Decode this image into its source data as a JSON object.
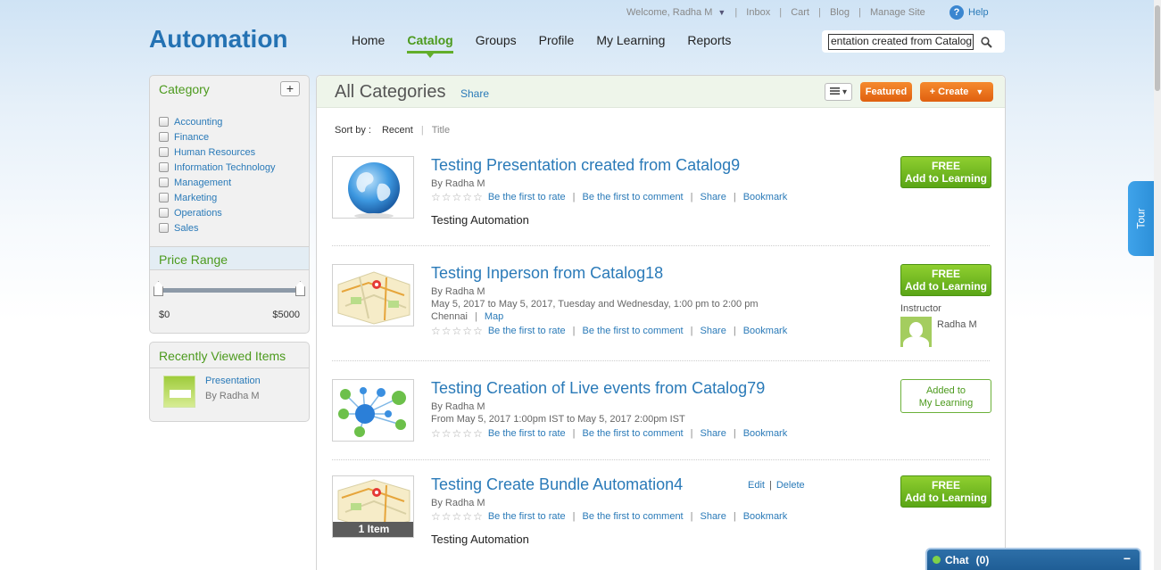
{
  "topbar": {
    "welcome": "Welcome, Radha M",
    "links": [
      "Inbox",
      "Cart",
      "Blog",
      "Manage Site"
    ],
    "help": "Help"
  },
  "logo": "Automation",
  "nav": [
    "Home",
    "Catalog",
    "Groups",
    "Profile",
    "My Learning",
    "Reports"
  ],
  "nav_active": "Catalog",
  "search": {
    "value": "entation created from Catalog"
  },
  "sidebar": {
    "category_title": "Category",
    "add_label": "+",
    "categories": [
      "Accounting",
      "Finance",
      "Human Resources",
      "Information Technology",
      "Management",
      "Marketing",
      "Operations",
      "Sales"
    ],
    "price_title": "Price Range",
    "price_min": "$0",
    "price_max": "$5000",
    "recent_title": "Recently Viewed Items",
    "recent_item_title": "Presentation",
    "recent_item_by": "By Radha M"
  },
  "main": {
    "title": "All Categories",
    "share": "Share",
    "featured": "Featured",
    "create": "+ Create",
    "sort_label": "Sort by :",
    "sort_recent": "Recent",
    "sort_title": "Title"
  },
  "common": {
    "rate": "Be the first to rate",
    "comment": "Be the first to comment",
    "share": "Share",
    "bookmark": "Bookmark",
    "free": "FREE",
    "add_to_learning": "Add to Learning"
  },
  "items": [
    {
      "title": "Testing Presentation created from Catalog9",
      "by": "By Radha M",
      "desc": "Testing Automation"
    },
    {
      "title": "Testing Inperson from Catalog18",
      "by": "By Radha M",
      "schedule": "May 5, 2017 to May 5, 2017, Tuesday and Wednesday, 1:00 pm to 2:00 pm",
      "location": "Chennai",
      "map": "Map",
      "instructor_label": "Instructor",
      "instructor_name": "Radha M"
    },
    {
      "title": "Testing Creation of Live events from Catalog79",
      "by": "By Radha M",
      "schedule": "From May 5, 2017 1:00pm IST to May 5, 2017 2:00pm IST",
      "added_line1": "Added to",
      "added_line2": "My Learning"
    },
    {
      "title": "Testing Create Bundle Automation4",
      "by": "By Radha M",
      "edit": "Edit",
      "delete": "Delete",
      "items_badge": "1 Item",
      "desc": "Testing Automation"
    }
  ],
  "tour": "Tour",
  "chat": {
    "label": "Chat",
    "count": "(0)",
    "minimize": "−"
  },
  "colors": {
    "brand_blue": "#2472b3",
    "accent_green": "#62ae2a",
    "orange": "#e0600f",
    "link": "#2a7ab8"
  }
}
